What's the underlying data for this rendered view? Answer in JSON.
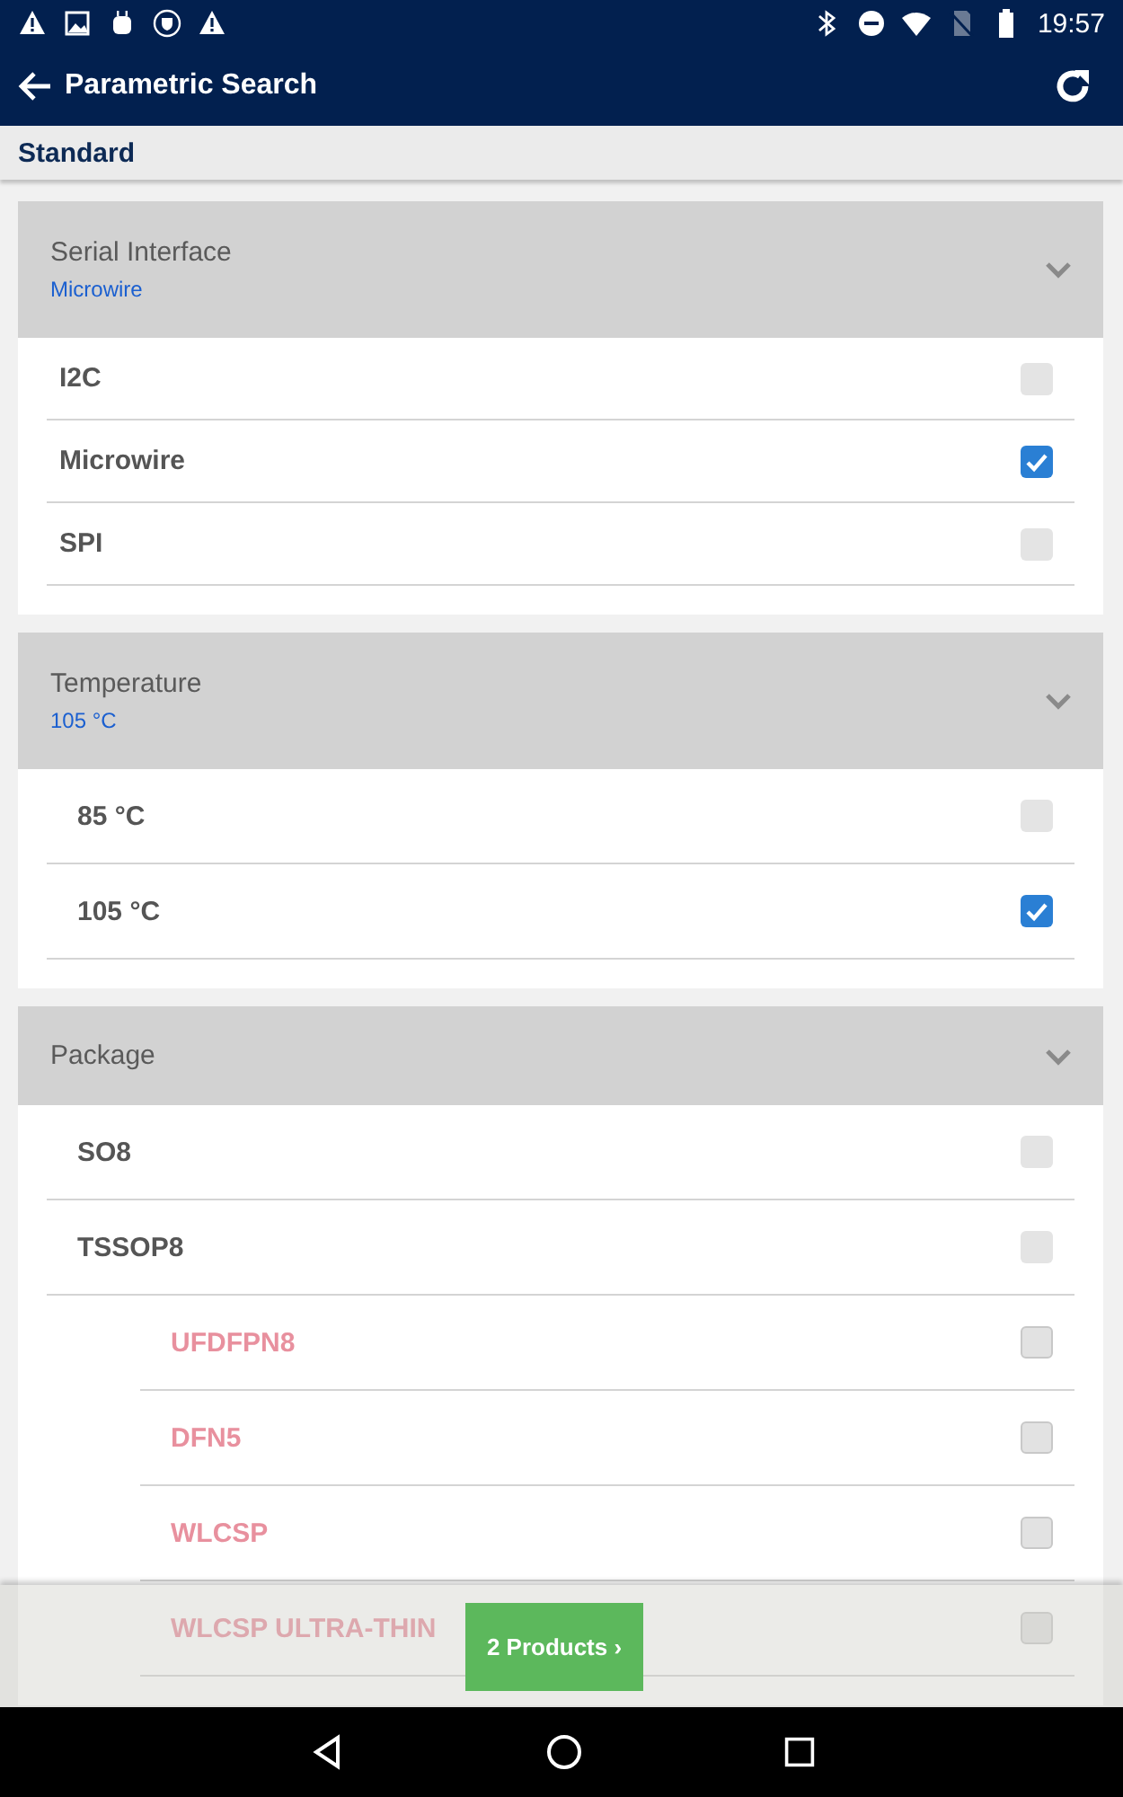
{
  "status_bar": {
    "time": "19:57"
  },
  "app_bar": {
    "title": "Parametric Search"
  },
  "section": {
    "title": "Standard"
  },
  "groups": [
    {
      "title": "Serial Interface",
      "value": "Microwire",
      "expanded": true,
      "options": [
        {
          "label": "I2C",
          "checked": false,
          "disabled": false
        },
        {
          "label": "Microwire",
          "checked": true,
          "disabled": false
        },
        {
          "label": "SPI",
          "checked": false,
          "disabled": false
        }
      ]
    },
    {
      "title": "Temperature",
      "value": "105 °C",
      "expanded": true,
      "options": [
        {
          "label": "85 °C",
          "checked": false,
          "disabled": false
        },
        {
          "label": "105 °C",
          "checked": true,
          "disabled": false
        }
      ]
    },
    {
      "title": "Package",
      "expanded": true,
      "options": [
        {
          "label": "SO8",
          "checked": false,
          "disabled": false
        },
        {
          "label": "TSSOP8",
          "checked": false,
          "disabled": false,
          "children": [
            {
              "label": "UFDFPN8",
              "checked": false,
              "disabled": true
            },
            {
              "label": "DFN5",
              "checked": false,
              "disabled": true
            },
            {
              "label": "WLCSP",
              "checked": false,
              "disabled": true
            },
            {
              "label": "WLCSP ULTRA-THIN",
              "checked": false,
              "disabled": true
            }
          ]
        }
      ]
    }
  ],
  "results_button": {
    "label": "2 Products ›"
  }
}
